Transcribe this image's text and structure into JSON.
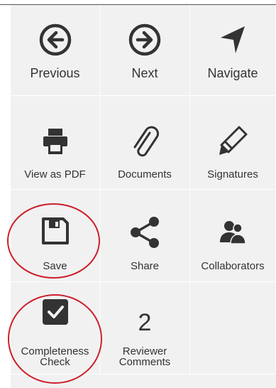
{
  "toolbar": {
    "previous": {
      "label": "Previous",
      "icon": "arrow-left-circle-icon"
    },
    "next": {
      "label": "Next",
      "icon": "arrow-right-circle-icon"
    },
    "navigate": {
      "label": "Navigate",
      "icon": "navigation-arrow-icon"
    },
    "view_pdf": {
      "label": "View as PDF",
      "icon": "printer-icon"
    },
    "documents": {
      "label": "Documents",
      "icon": "paperclip-icon"
    },
    "signatures": {
      "label": "Signatures",
      "icon": "pencil-icon"
    },
    "save": {
      "label": "Save",
      "icon": "floppy-disk-icon"
    },
    "share": {
      "label": "Share",
      "icon": "share-icon"
    },
    "collaborators": {
      "label": "Collaborators",
      "icon": "users-icon"
    },
    "completeness": {
      "label_line1": "Completeness",
      "label_line2": "Check",
      "icon": "checkbox-checked-icon"
    },
    "reviewer_comments": {
      "count": "2",
      "label_line1": "Reviewer",
      "label_line2": "Comments"
    }
  },
  "colors": {
    "tile_bg": "#f1f1f1",
    "icon": "#333333",
    "count": "#6aa84f",
    "highlight": "#cc1f2a"
  }
}
